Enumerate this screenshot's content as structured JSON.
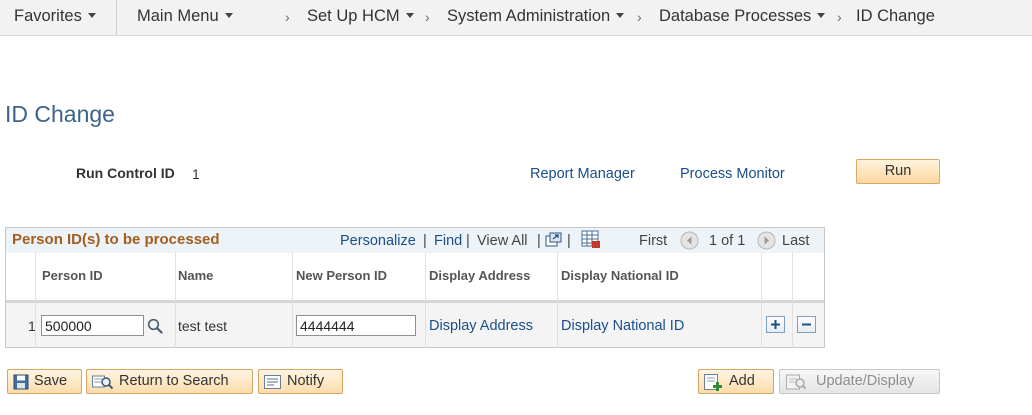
{
  "nav": {
    "favorites": "Favorites",
    "main_menu": "Main Menu",
    "crumbs": [
      "Set Up HCM",
      "System Administration",
      "Database Processes",
      "ID Change"
    ]
  },
  "page": {
    "title": "ID Change",
    "run_control_label": "Run Control ID",
    "run_control_value": "1",
    "report_manager": "Report Manager",
    "process_monitor": "Process Monitor",
    "run_button": "Run"
  },
  "grid": {
    "title": "Person ID(s) to be processed",
    "personalize": "Personalize",
    "find": "Find",
    "view_all": "View All",
    "first": "First",
    "range": "1 of 1",
    "last": "Last",
    "columns": [
      "Person ID",
      "Name",
      "New Person ID",
      "Display Address",
      "Display National ID"
    ],
    "rows": [
      {
        "num": "1",
        "person_id": "500000",
        "name": "test test",
        "new_person_id": "4444444",
        "display_address": "Display Address",
        "display_national_id": "Display National ID"
      }
    ]
  },
  "toolbar": {
    "save": "Save",
    "return_to_search": "Return to Search",
    "notify": "Notify",
    "add": "Add",
    "update_display": "Update/Display"
  },
  "colors": {
    "link": "#1a4f8b",
    "title": "#3f6386",
    "grid_title": "#a35d20",
    "button_orange": "#fcd7a0"
  }
}
